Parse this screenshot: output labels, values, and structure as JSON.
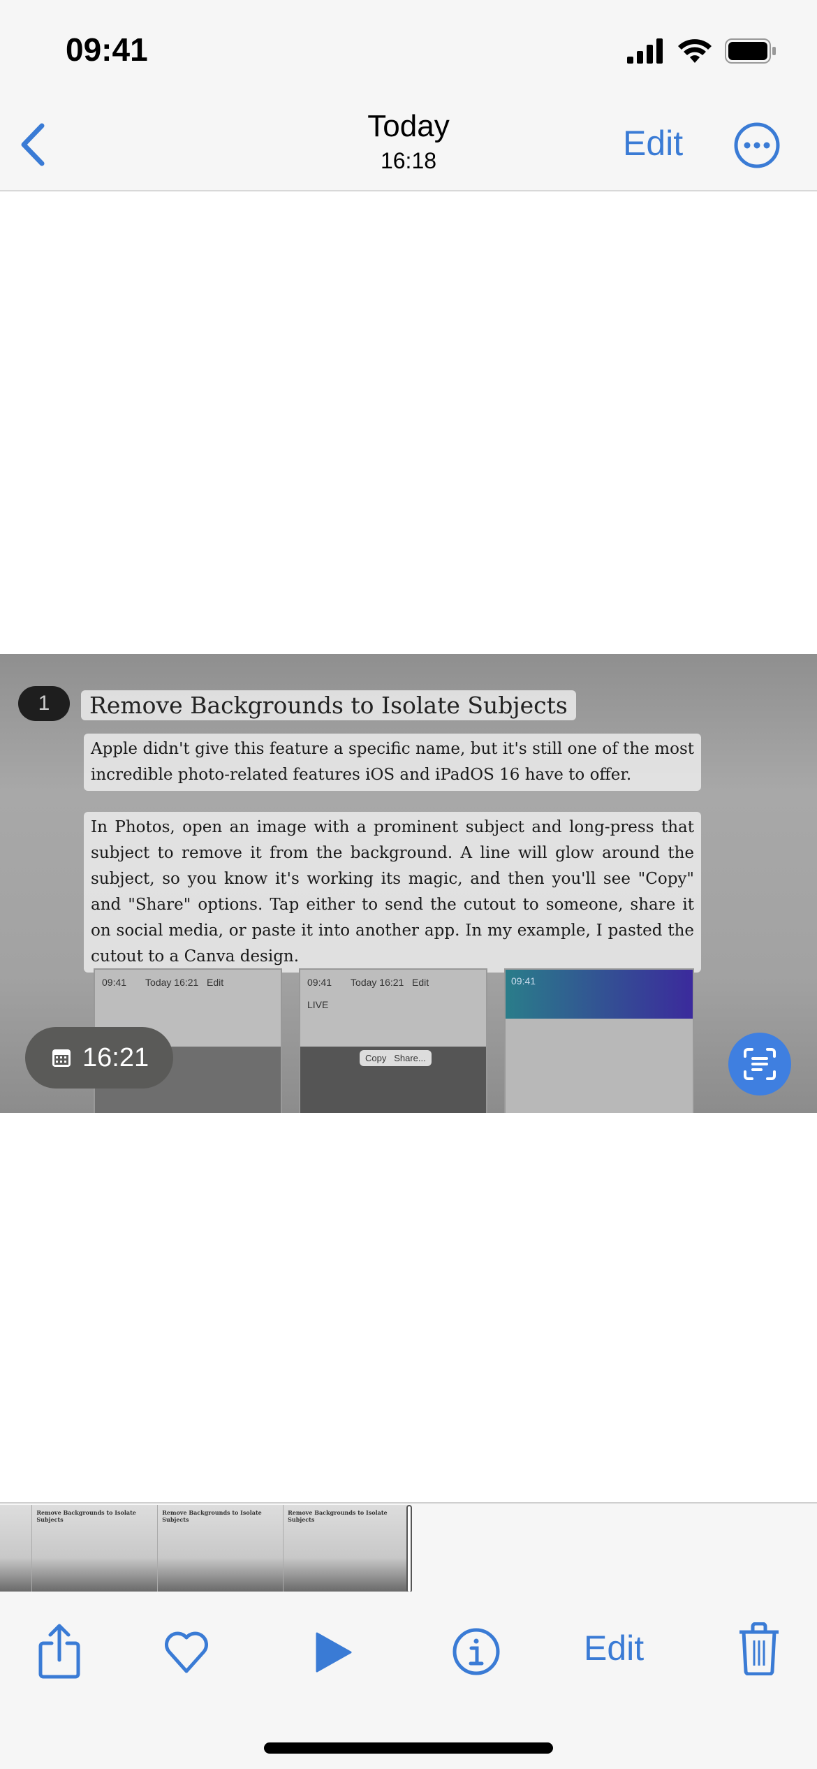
{
  "status_bar": {
    "time": "09:41"
  },
  "nav": {
    "title": "Today",
    "subtitle": "16:18",
    "edit_label": "Edit"
  },
  "photo": {
    "step_number": "1",
    "heading": "Remove Backgrounds to Isolate Subjects",
    "paragraph1": "Apple didn't give this feature a specific name, but it's still one of the most incredible photo-related features iOS and iPadOS 16 have to offer.",
    "paragraph2": "In Photos, open an image with a prominent subject and long-press that subject to remove it from the background. A line will glow around the subject, so you know it's working its magic, and then you'll see \"Copy\" and \"Share\" options. Tap either to send the cutout to someone, share it on social media, or paste it into another app. In my example, I pasted the cutout to a Canva design.",
    "shots": [
      {
        "time": "09:41",
        "title": "Today",
        "sub": "16:21",
        "edit": "Edit"
      },
      {
        "time": "09:41",
        "title": "Today",
        "sub": "16:21",
        "edit": "Edit",
        "live": "LIVE",
        "copy": "Copy",
        "share": "Share..."
      },
      {
        "time": "09:41"
      }
    ],
    "timestamp_badge": "16:21"
  },
  "scrubber": {
    "thumb_heading": "Remove Backgrounds to Isolate Subjects"
  },
  "toolbar": {
    "edit_label": "Edit"
  },
  "colors": {
    "accent": "#3a7bd5",
    "live_text_button": "#3f7fe0"
  }
}
